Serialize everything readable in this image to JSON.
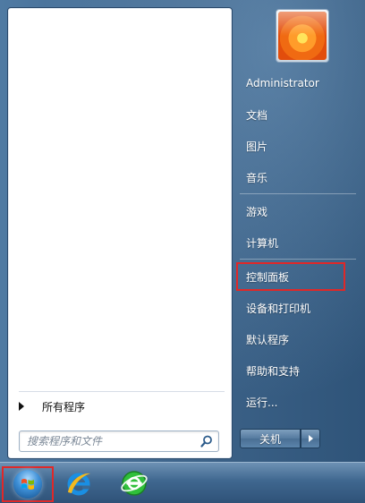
{
  "start_menu": {
    "left_pane": {
      "all_programs_label": "所有程序",
      "search_placeholder": "搜索程序和文件"
    },
    "right_pane": {
      "user_name": "Administrator",
      "items": [
        {
          "label": "文档"
        },
        {
          "label": "图片"
        },
        {
          "label": "音乐"
        },
        {
          "label": "游戏"
        },
        {
          "label": "计算机"
        },
        {
          "label": "控制面板"
        },
        {
          "label": "设备和打印机"
        },
        {
          "label": "默认程序"
        },
        {
          "label": "帮助和支持"
        },
        {
          "label": "运行..."
        }
      ],
      "shutdown_label": "关机"
    }
  },
  "taskbar": {
    "icons": [
      "start-orb-icon",
      "internet-explorer-icon",
      "browser-icon"
    ]
  },
  "colors": {
    "highlight": "#e02828"
  }
}
